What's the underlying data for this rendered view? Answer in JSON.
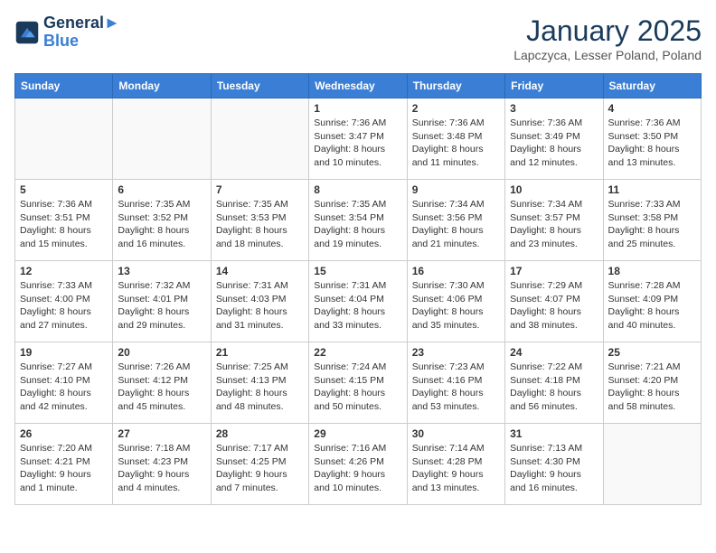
{
  "logo": {
    "line1": "General",
    "line2": "Blue"
  },
  "title": "January 2025",
  "location": "Lapczyca, Lesser Poland, Poland",
  "weekdays": [
    "Sunday",
    "Monday",
    "Tuesday",
    "Wednesday",
    "Thursday",
    "Friday",
    "Saturday"
  ],
  "weeks": [
    [
      {
        "day": "",
        "info": ""
      },
      {
        "day": "",
        "info": ""
      },
      {
        "day": "",
        "info": ""
      },
      {
        "day": "1",
        "info": "Sunrise: 7:36 AM\nSunset: 3:47 PM\nDaylight: 8 hours\nand 10 minutes."
      },
      {
        "day": "2",
        "info": "Sunrise: 7:36 AM\nSunset: 3:48 PM\nDaylight: 8 hours\nand 11 minutes."
      },
      {
        "day": "3",
        "info": "Sunrise: 7:36 AM\nSunset: 3:49 PM\nDaylight: 8 hours\nand 12 minutes."
      },
      {
        "day": "4",
        "info": "Sunrise: 7:36 AM\nSunset: 3:50 PM\nDaylight: 8 hours\nand 13 minutes."
      }
    ],
    [
      {
        "day": "5",
        "info": "Sunrise: 7:36 AM\nSunset: 3:51 PM\nDaylight: 8 hours\nand 15 minutes."
      },
      {
        "day": "6",
        "info": "Sunrise: 7:35 AM\nSunset: 3:52 PM\nDaylight: 8 hours\nand 16 minutes."
      },
      {
        "day": "7",
        "info": "Sunrise: 7:35 AM\nSunset: 3:53 PM\nDaylight: 8 hours\nand 18 minutes."
      },
      {
        "day": "8",
        "info": "Sunrise: 7:35 AM\nSunset: 3:54 PM\nDaylight: 8 hours\nand 19 minutes."
      },
      {
        "day": "9",
        "info": "Sunrise: 7:34 AM\nSunset: 3:56 PM\nDaylight: 8 hours\nand 21 minutes."
      },
      {
        "day": "10",
        "info": "Sunrise: 7:34 AM\nSunset: 3:57 PM\nDaylight: 8 hours\nand 23 minutes."
      },
      {
        "day": "11",
        "info": "Sunrise: 7:33 AM\nSunset: 3:58 PM\nDaylight: 8 hours\nand 25 minutes."
      }
    ],
    [
      {
        "day": "12",
        "info": "Sunrise: 7:33 AM\nSunset: 4:00 PM\nDaylight: 8 hours\nand 27 minutes."
      },
      {
        "day": "13",
        "info": "Sunrise: 7:32 AM\nSunset: 4:01 PM\nDaylight: 8 hours\nand 29 minutes."
      },
      {
        "day": "14",
        "info": "Sunrise: 7:31 AM\nSunset: 4:03 PM\nDaylight: 8 hours\nand 31 minutes."
      },
      {
        "day": "15",
        "info": "Sunrise: 7:31 AM\nSunset: 4:04 PM\nDaylight: 8 hours\nand 33 minutes."
      },
      {
        "day": "16",
        "info": "Sunrise: 7:30 AM\nSunset: 4:06 PM\nDaylight: 8 hours\nand 35 minutes."
      },
      {
        "day": "17",
        "info": "Sunrise: 7:29 AM\nSunset: 4:07 PM\nDaylight: 8 hours\nand 38 minutes."
      },
      {
        "day": "18",
        "info": "Sunrise: 7:28 AM\nSunset: 4:09 PM\nDaylight: 8 hours\nand 40 minutes."
      }
    ],
    [
      {
        "day": "19",
        "info": "Sunrise: 7:27 AM\nSunset: 4:10 PM\nDaylight: 8 hours\nand 42 minutes."
      },
      {
        "day": "20",
        "info": "Sunrise: 7:26 AM\nSunset: 4:12 PM\nDaylight: 8 hours\nand 45 minutes."
      },
      {
        "day": "21",
        "info": "Sunrise: 7:25 AM\nSunset: 4:13 PM\nDaylight: 8 hours\nand 48 minutes."
      },
      {
        "day": "22",
        "info": "Sunrise: 7:24 AM\nSunset: 4:15 PM\nDaylight: 8 hours\nand 50 minutes."
      },
      {
        "day": "23",
        "info": "Sunrise: 7:23 AM\nSunset: 4:16 PM\nDaylight: 8 hours\nand 53 minutes."
      },
      {
        "day": "24",
        "info": "Sunrise: 7:22 AM\nSunset: 4:18 PM\nDaylight: 8 hours\nand 56 minutes."
      },
      {
        "day": "25",
        "info": "Sunrise: 7:21 AM\nSunset: 4:20 PM\nDaylight: 8 hours\nand 58 minutes."
      }
    ],
    [
      {
        "day": "26",
        "info": "Sunrise: 7:20 AM\nSunset: 4:21 PM\nDaylight: 9 hours\nand 1 minute."
      },
      {
        "day": "27",
        "info": "Sunrise: 7:18 AM\nSunset: 4:23 PM\nDaylight: 9 hours\nand 4 minutes."
      },
      {
        "day": "28",
        "info": "Sunrise: 7:17 AM\nSunset: 4:25 PM\nDaylight: 9 hours\nand 7 minutes."
      },
      {
        "day": "29",
        "info": "Sunrise: 7:16 AM\nSunset: 4:26 PM\nDaylight: 9 hours\nand 10 minutes."
      },
      {
        "day": "30",
        "info": "Sunrise: 7:14 AM\nSunset: 4:28 PM\nDaylight: 9 hours\nand 13 minutes."
      },
      {
        "day": "31",
        "info": "Sunrise: 7:13 AM\nSunset: 4:30 PM\nDaylight: 9 hours\nand 16 minutes."
      },
      {
        "day": "",
        "info": ""
      }
    ]
  ]
}
